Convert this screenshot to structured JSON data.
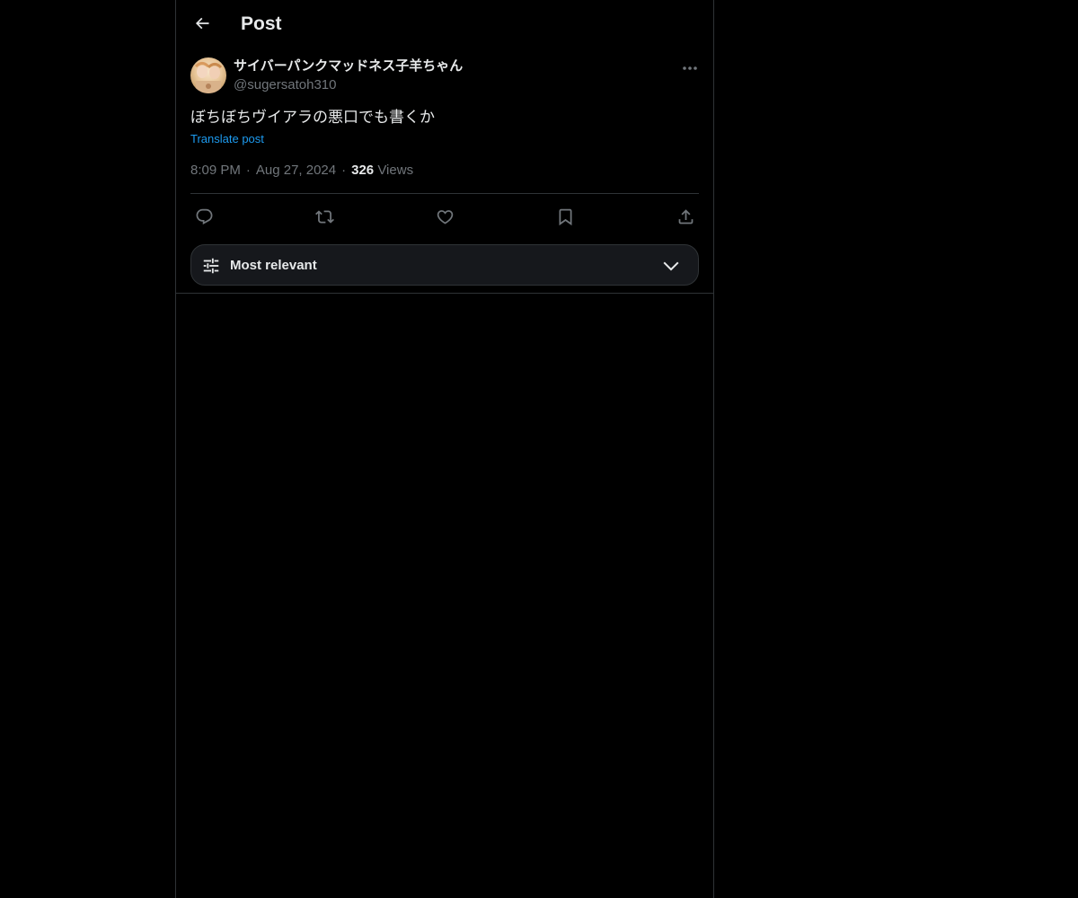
{
  "header": {
    "title": "Post",
    "back_icon": "arrow-left-icon"
  },
  "post": {
    "author": {
      "display_name": "サイバーパンクマッドネス子羊ちゃん",
      "handle": "@sugersatoh310"
    },
    "text": "ぼちぼちヴイアラの悪口でも書くか",
    "translate_label": "Translate post",
    "time": "8:09 PM",
    "date": "Aug 27, 2024",
    "views_count": "326",
    "views_label": "Views",
    "separator": "·"
  },
  "actions": [
    "reply-icon",
    "retweet-icon",
    "like-icon",
    "bookmark-icon",
    "share-icon"
  ],
  "sort": {
    "label": "Most relevant",
    "icon": "sliders-icon"
  },
  "colors": {
    "background": "#000000",
    "text": "#e7e9ea",
    "secondary": "#71767b",
    "accent": "#1d9bf0",
    "border": "#2f3336"
  }
}
